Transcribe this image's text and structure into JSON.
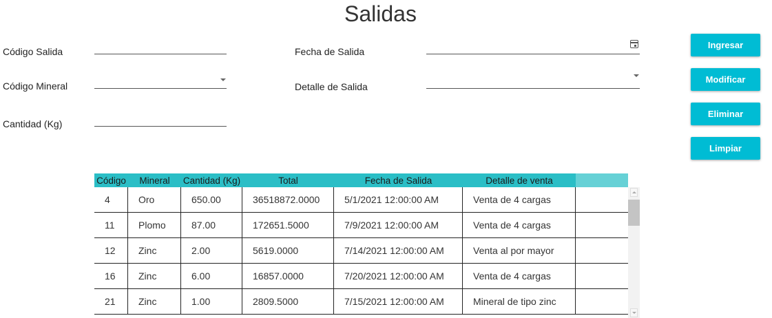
{
  "page": {
    "title": "Salidas"
  },
  "form": {
    "codigo_salida": {
      "label": "Código Salida",
      "value": ""
    },
    "codigo_mineral": {
      "label": "Código Mineral",
      "value": ""
    },
    "cantidad": {
      "label": "Cantidad (Kg)",
      "value": ""
    },
    "fecha_salida": {
      "label": "Fecha de Salida",
      "value": ""
    },
    "detalle_salida": {
      "label": "Detalle de Salida",
      "value": ""
    }
  },
  "buttons": {
    "ingresar": "Ingresar",
    "modificar": "Modificar",
    "eliminar": "Eliminar",
    "limpiar": "Limpiar"
  },
  "table": {
    "columns": [
      "Código",
      "Mineral",
      "Cantidad (Kg)",
      "Total",
      "Fecha de Salida",
      "Detalle de venta"
    ],
    "rows": [
      [
        "4",
        "Oro",
        "650.00",
        "36518872.0000",
        "5/1/2021 12:00:00 AM",
        "Venta de 4 cargas"
      ],
      [
        "11",
        "Plomo",
        "87.00",
        "172651.5000",
        "7/9/2021 12:00:00 AM",
        "Venta de 4 cargas"
      ],
      [
        "12",
        "Zinc",
        "2.00",
        "5619.0000",
        "7/14/2021 12:00:00 AM",
        "Venta al por mayor"
      ],
      [
        "16",
        "Zinc",
        "6.00",
        "16857.0000",
        "7/20/2021 12:00:00 AM",
        "Venta de 4 cargas"
      ],
      [
        "21",
        "Zinc",
        "1.00",
        "2809.5000",
        "7/15/2021 12:00:00 AM",
        "Mineral de tipo zinc"
      ]
    ]
  },
  "icons": {
    "calendar": "calendar-icon",
    "dropdown": "chevron-down-icon"
  },
  "colors": {
    "accent": "#00bcd4",
    "header": "#2bbec6",
    "header_fill": "#66d1d6"
  }
}
